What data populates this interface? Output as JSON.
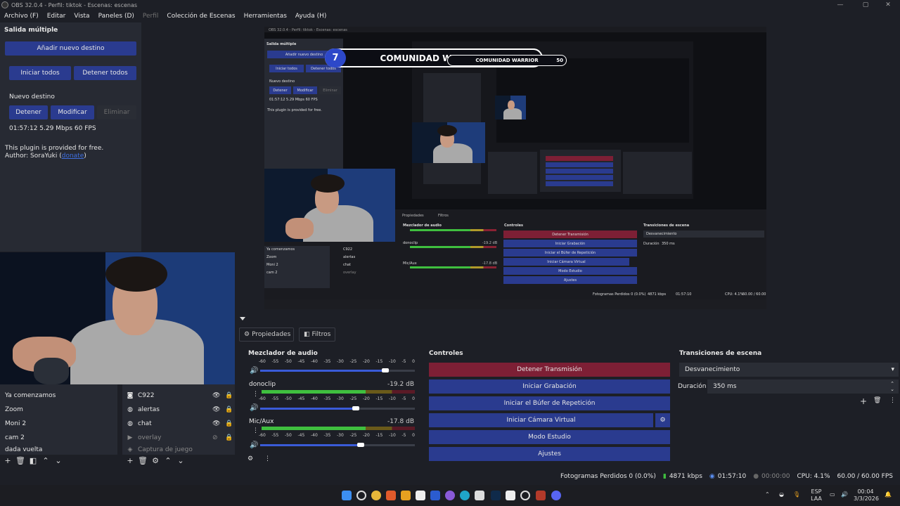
{
  "window": {
    "title": "OBS 32.0.4 - Perfil: tiktok - Escenas: escenas"
  },
  "menu": [
    "Archivo (F)",
    "Editar",
    "Vista",
    "Paneles (D)",
    "Perfil",
    "Colección de Escenas",
    "Herramientas",
    "Ayuda (H)"
  ],
  "multioutput": {
    "title": "Salida múltiple",
    "add_target": "Añadir nuevo destino",
    "start_all": "Iniciar todos",
    "stop_all": "Detener todos",
    "target_name": "Nuevo destino",
    "stop": "Detener",
    "modify": "Modificar",
    "remove": "Eliminar",
    "stats": "01:57:12  5.29 Mbps  60 FPS",
    "note": "This plugin is provided for free.",
    "author_prefix": "Author: SoraYuki (",
    "author_link": "donate",
    "author_suffix": ")"
  },
  "banner": {
    "left": "7",
    "label": "COMUNIDAD WARRIOR",
    "right": "50"
  },
  "tabs": {
    "properties": "Propiedades",
    "filters": "Filtros"
  },
  "scenes": [
    "Ya comenzamos",
    "Zoom",
    "Moni 2",
    "cam 2",
    "dada vuelta"
  ],
  "sources": [
    {
      "name": "C922",
      "icon": "camera-icon"
    },
    {
      "name": "alertas",
      "icon": "globe-icon"
    },
    {
      "name": "chat",
      "icon": "globe-icon"
    },
    {
      "name": "overlay",
      "icon": "play-icon"
    },
    {
      "name": "Captura de juego",
      "icon": "gamepad-icon"
    }
  ],
  "mixer": {
    "title": "Mezclador de audio",
    "ticks": [
      "-60",
      "-55",
      "-50",
      "-45",
      "-40",
      "-35",
      "-30",
      "-25",
      "-20",
      "-15",
      "-10",
      "-5",
      "0"
    ],
    "channels": [
      {
        "name": "donoclip",
        "db": "-19.2 dB",
        "level": 0.72,
        "volume": 0.62
      },
      {
        "name": "Mic/Aux",
        "db": "-17.8 dB",
        "level": 0.68,
        "volume": 0.65
      }
    ],
    "first_volume": 0.81
  },
  "controls": {
    "title": "Controles",
    "stop_stream": "Detener Transmisión",
    "start_record": "Iniciar Grabación",
    "replay_buffer": "Iniciar el Búfer de Repetición",
    "virtual_cam": "Iniciar Cámara Virtual",
    "studio_mode": "Modo Estudio",
    "settings": "Ajustes"
  },
  "transitions": {
    "title": "Transiciones de escena",
    "selected": "Desvanecimiento",
    "duration_label": "Duración",
    "duration_value": "350 ms"
  },
  "status": {
    "dropped": "Fotogramas Perdidos 0 (0.0%)",
    "bitrate": "4871 kbps",
    "stream_time": "01:57:10",
    "record_time": "00:00:00",
    "cpu": "CPU: 4.1%",
    "fps": "60.00 / 60.00 FPS"
  },
  "tray": {
    "lang1": "ESP",
    "lang2": "LAA",
    "time": "00:04",
    "date": "3/3/2026"
  },
  "colors": {
    "accent_blue": "#2a3b8f",
    "stop_red": "#7d1f35",
    "meter_green": "#3fbf3f"
  }
}
